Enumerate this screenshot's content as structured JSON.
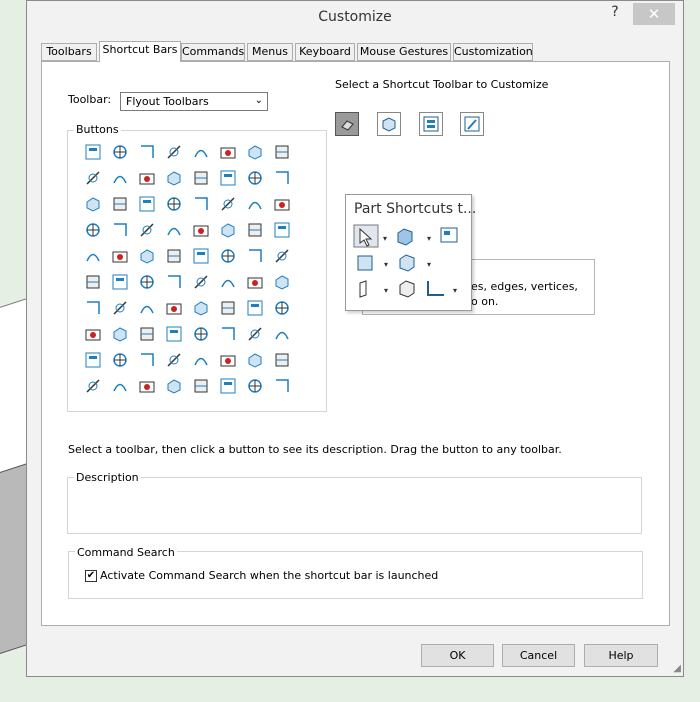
{
  "window": {
    "title": "Customize",
    "help_glyph": "?",
    "close_glyph": "✕"
  },
  "tabs": [
    {
      "label": "Toolbars"
    },
    {
      "label": "Shortcut Bars"
    },
    {
      "label": "Commands"
    },
    {
      "label": "Menus"
    },
    {
      "label": "Keyboard"
    },
    {
      "label": "Mouse Gestures"
    },
    {
      "label": "Customization"
    }
  ],
  "active_tab": "Shortcut Bars",
  "toolbar_select": {
    "label": "Toolbar:",
    "value": "Flyout Toolbars",
    "arrow": "⌄"
  },
  "buttons_group": {
    "label": "Buttons",
    "icon_count": 80
  },
  "shortcut_heading": "Select a Shortcut Toolbar to Customize",
  "shortcut_toolbars": [
    "part-shortcut-icon",
    "assembly-shortcut-icon",
    "drawing-shortcut-icon",
    "sketch-shortcut-icon"
  ],
  "popup": {
    "title": "Part Shortcuts t...",
    "behind_text_line1": "es, edges, vertices,",
    "behind_text_line2": "o on."
  },
  "hint": "Select a toolbar, then click a button to see its description. Drag the button to any toolbar.",
  "description": {
    "label": "Description"
  },
  "command_search": {
    "label": "Command Search",
    "checkbox_label": "Activate Command Search when the shortcut bar is launched",
    "checked": true,
    "check_glyph": "✔"
  },
  "buttons": {
    "ok": "OK",
    "cancel": "Cancel",
    "help": "Help"
  },
  "colors": {
    "icon_blue": "#1f7fbf",
    "icon_dark": "#333333",
    "accent_red": "#cc2222"
  }
}
